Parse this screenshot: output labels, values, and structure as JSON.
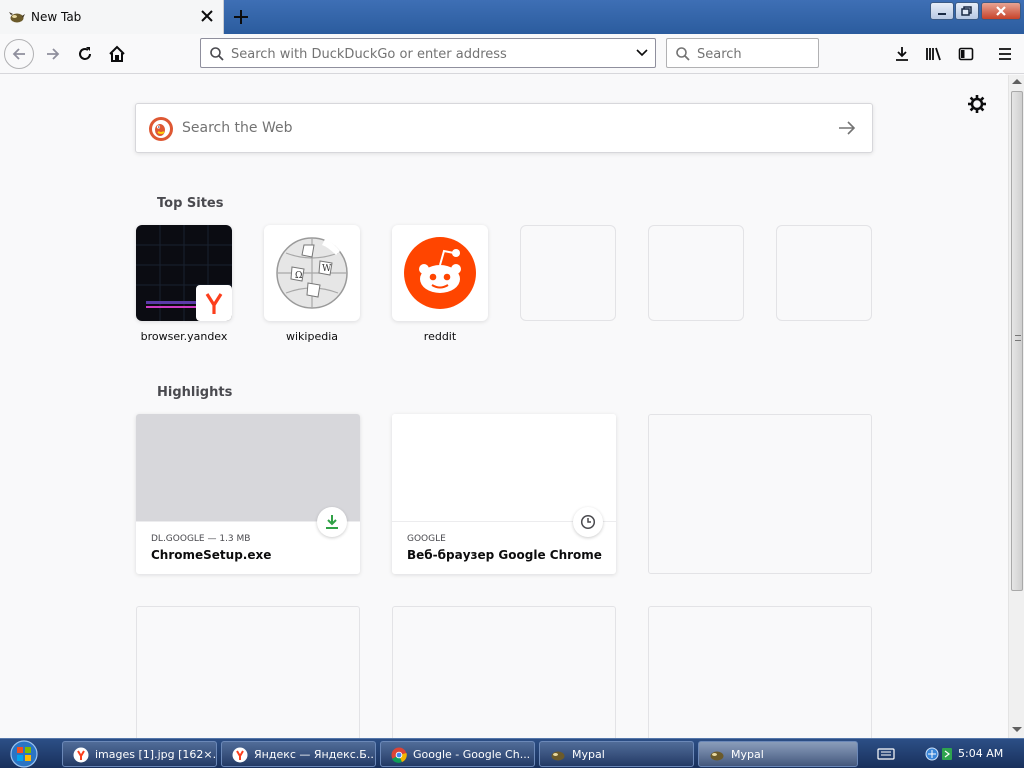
{
  "window": {
    "tab_title": "New Tab"
  },
  "navbar": {
    "url_placeholder": "Search with DuckDuckGo or enter address",
    "search_placeholder": "Search"
  },
  "page": {
    "web_search_placeholder": "Search the Web",
    "top_sites_heading": "Top Sites",
    "highlights_heading": "Highlights",
    "top_sites": [
      {
        "label": "browser.yandex"
      },
      {
        "label": "wikipedia"
      },
      {
        "label": "reddit"
      }
    ],
    "highlights": [
      {
        "source": "DL.GOOGLE — 1.3 MB",
        "title": "ChromeSetup.exe",
        "badge_icon": "download-icon"
      },
      {
        "source": "GOOGLE",
        "title": "Веб-браузер Google Chrome",
        "badge_icon": "clock-icon"
      }
    ]
  },
  "taskbar": {
    "tasks": [
      {
        "label": "images [1].jpg [162×..."
      },
      {
        "label": "Яндекс — Яндекс.Б..."
      },
      {
        "label": "Google - Google Ch..."
      },
      {
        "label": "Mypal"
      },
      {
        "label": "Mypal"
      }
    ],
    "clock": "5:04 AM"
  },
  "colors": {
    "accent_blue": "#0a84ff",
    "reddit_orange": "#ff4500",
    "yandex_red": "#fc3f1d",
    "download_green": "#30a146",
    "ddg_orange": "#de5833"
  }
}
